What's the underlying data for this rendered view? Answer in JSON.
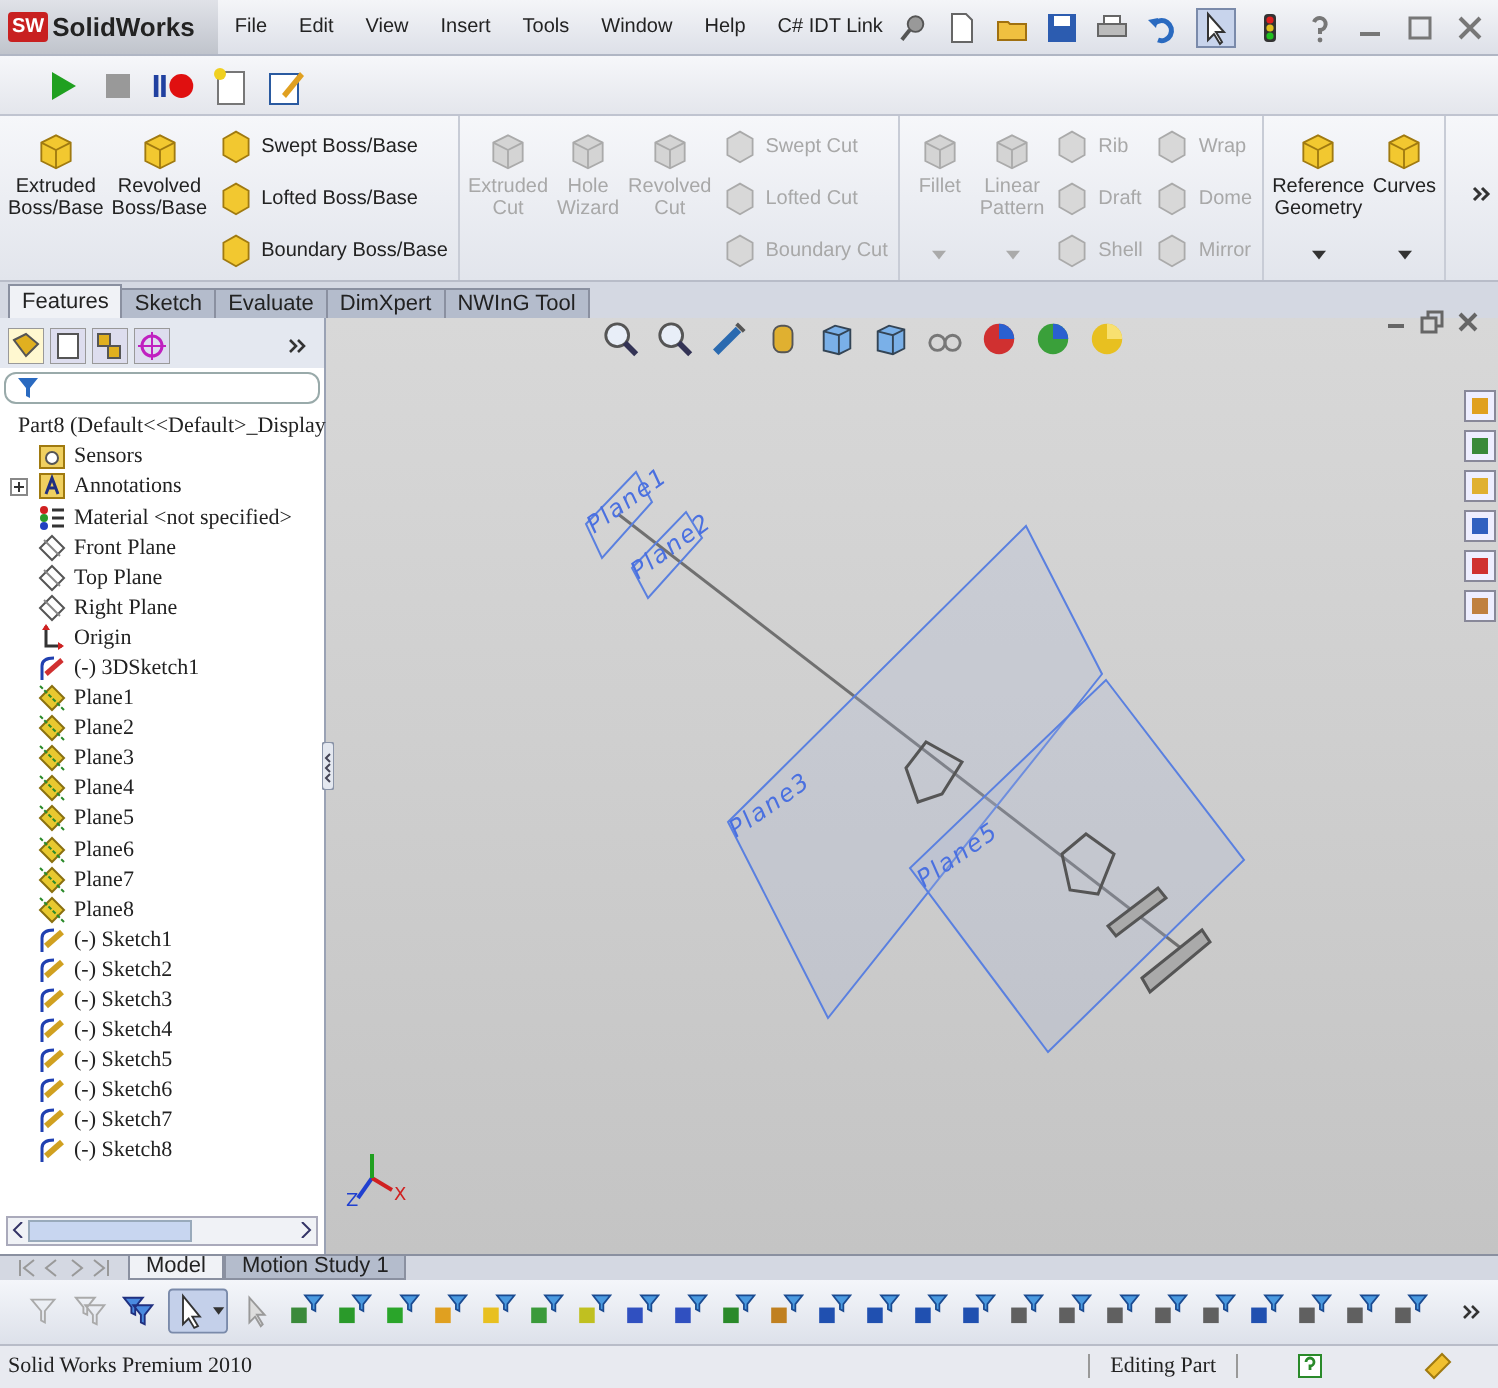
{
  "app": {
    "logo_mark": "SW",
    "logo": "SolidWorks"
  },
  "menu": [
    "File",
    "Edit",
    "View",
    "Insert",
    "Tools",
    "Window",
    "Help",
    "C# IDT Link"
  ],
  "ribbon": {
    "groups": [
      {
        "columns": [
          {
            "kind": "large",
            "items": [
              {
                "label": "Extruded Boss/Base",
                "disabled": false
              }
            ]
          },
          {
            "kind": "large",
            "items": [
              {
                "label": "Revolved Boss/Base",
                "disabled": false
              }
            ]
          },
          {
            "kind": "stack",
            "items": [
              {
                "label": "Swept Boss/Base",
                "disabled": false
              },
              {
                "label": "Lofted Boss/Base",
                "disabled": false
              },
              {
                "label": "Boundary Boss/Base",
                "disabled": false
              }
            ]
          }
        ]
      },
      {
        "columns": [
          {
            "kind": "large",
            "items": [
              {
                "label": "Extruded Cut",
                "disabled": true
              }
            ]
          },
          {
            "kind": "large",
            "items": [
              {
                "label": "Hole Wizard",
                "disabled": true
              }
            ]
          },
          {
            "kind": "large",
            "items": [
              {
                "label": "Revolved Cut",
                "disabled": true
              }
            ]
          },
          {
            "kind": "stack",
            "items": [
              {
                "label": "Swept Cut",
                "disabled": true
              },
              {
                "label": "Lofted Cut",
                "disabled": true
              },
              {
                "label": "Boundary Cut",
                "disabled": true
              }
            ]
          }
        ]
      },
      {
        "columns": [
          {
            "kind": "large",
            "dropdown": true,
            "items": [
              {
                "label": "Fillet",
                "disabled": true
              }
            ]
          },
          {
            "kind": "large",
            "dropdown": true,
            "items": [
              {
                "label": "Linear Pattern",
                "disabled": true
              }
            ]
          },
          {
            "kind": "stack",
            "items": [
              {
                "label": "Rib",
                "disabled": true
              },
              {
                "label": "Draft",
                "disabled": true
              },
              {
                "label": "Shell",
                "disabled": true
              }
            ]
          },
          {
            "kind": "stack",
            "items": [
              {
                "label": "Wrap",
                "disabled": true
              },
              {
                "label": "Dome",
                "disabled": true
              },
              {
                "label": "Mirror",
                "disabled": true
              }
            ]
          }
        ]
      },
      {
        "columns": [
          {
            "kind": "large",
            "dropdown": true,
            "items": [
              {
                "label": "Reference Geometry",
                "disabled": false
              }
            ]
          },
          {
            "kind": "large",
            "dropdown": true,
            "items": [
              {
                "label": "Curves",
                "disabled": false
              }
            ]
          }
        ]
      }
    ]
  },
  "tabs": [
    {
      "label": "Features",
      "selected": true
    },
    {
      "label": "Sketch",
      "selected": false
    },
    {
      "label": "Evaluate",
      "selected": false
    },
    {
      "label": "DimXpert",
      "selected": false
    },
    {
      "label": "NWInG Tool",
      "selected": false
    }
  ],
  "tree": {
    "root": {
      "label": "Part8  (Default<<Default>_Display",
      "kind": "part",
      "children": [
        {
          "label": "Sensors",
          "kind": "sensors"
        },
        {
          "label": "Annotations",
          "kind": "annotations",
          "expanded": false
        },
        {
          "label": "Material <not specified>",
          "kind": "material"
        },
        {
          "label": "Front Plane",
          "kind": "plane"
        },
        {
          "label": "Top Plane",
          "kind": "plane"
        },
        {
          "label": "Right Plane",
          "kind": "plane"
        },
        {
          "label": "Origin",
          "kind": "origin"
        },
        {
          "label": "(-) 3DSketch1",
          "kind": "sketch3d"
        },
        {
          "label": "Plane1",
          "kind": "refplane"
        },
        {
          "label": "Plane2",
          "kind": "refplane"
        },
        {
          "label": "Plane3",
          "kind": "refplane"
        },
        {
          "label": "Plane4",
          "kind": "refplane"
        },
        {
          "label": "Plane5",
          "kind": "refplane"
        },
        {
          "label": "Plane6",
          "kind": "refplane"
        },
        {
          "label": "Plane7",
          "kind": "refplane"
        },
        {
          "label": "Plane8",
          "kind": "refplane"
        },
        {
          "label": "(-) Sketch1",
          "kind": "sketch"
        },
        {
          "label": "(-) Sketch2",
          "kind": "sketch"
        },
        {
          "label": "(-) Sketch3",
          "kind": "sketch"
        },
        {
          "label": "(-) Sketch4",
          "kind": "sketch"
        },
        {
          "label": "(-) Sketch5",
          "kind": "sketch"
        },
        {
          "label": "(-) Sketch6",
          "kind": "sketch"
        },
        {
          "label": "(-) Sketch7",
          "kind": "sketch"
        },
        {
          "label": "(-) Sketch8",
          "kind": "sketch"
        }
      ]
    }
  },
  "viewport": {
    "plane_labels": [
      "Plane1",
      "Plane2",
      "Plane3",
      "Plane5"
    ],
    "triad_labels": [
      "Z",
      "X"
    ]
  },
  "bottom_tabs": [
    {
      "label": "Model",
      "selected": true
    },
    {
      "label": "Motion Study 1",
      "selected": false
    }
  ],
  "status_bar": {
    "product": "Solid Works Premium 2010",
    "mode": "Editing Part"
  }
}
